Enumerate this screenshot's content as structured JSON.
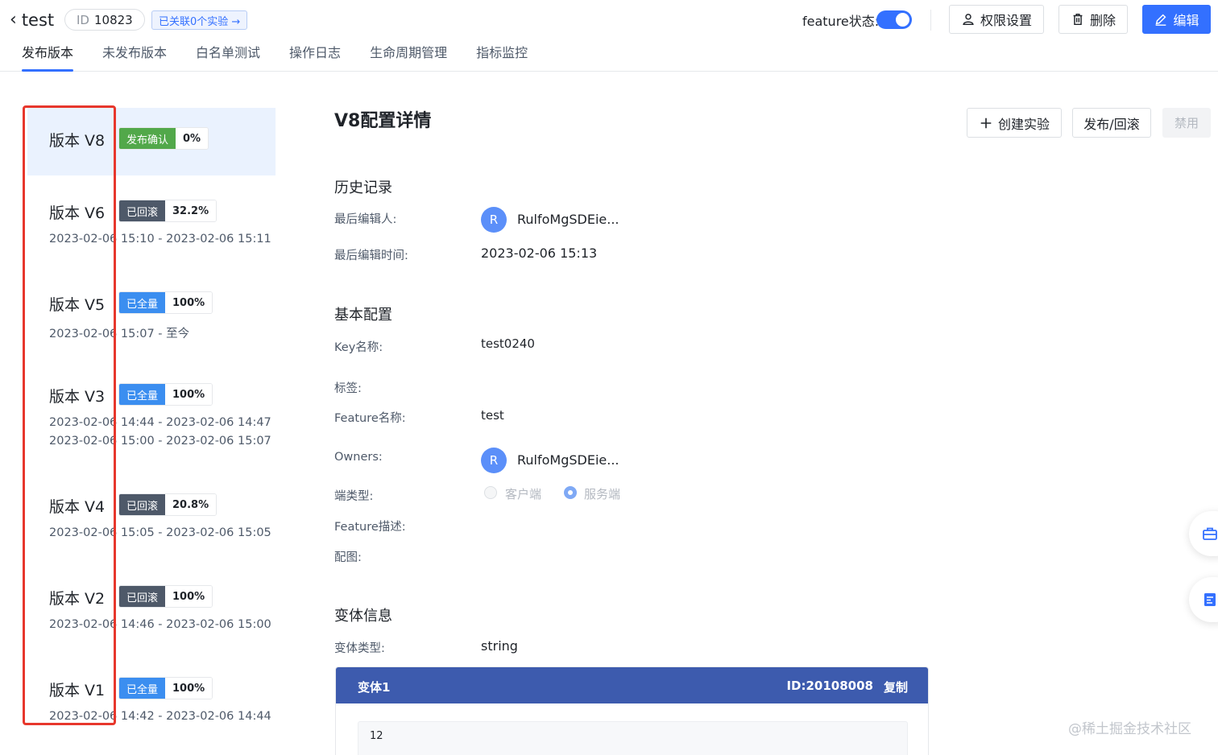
{
  "header": {
    "back_label": "test",
    "id_key": "ID",
    "id_value": "10823",
    "linked_label": "已关联0个实验 →",
    "feature_status_label": "feature状态:",
    "feature_status_on": true,
    "permissions_label": "权限设置",
    "delete_label": "删除",
    "edit_label": "编辑"
  },
  "tabs": [
    {
      "label": "发布版本",
      "active": true
    },
    {
      "label": "未发布版本",
      "active": false
    },
    {
      "label": "白名单测试",
      "active": false
    },
    {
      "label": "操作日志",
      "active": false
    },
    {
      "label": "生命周期管理",
      "active": false
    },
    {
      "label": "指标监控",
      "active": false
    }
  ],
  "versions": [
    {
      "title": "版本 V8",
      "status": "发布确认",
      "status_color": "#52a84a",
      "percent": "0%",
      "ranges": [],
      "selected": true
    },
    {
      "title": "版本 V6",
      "status": "已回滚",
      "status_color": "#4e5969",
      "percent": "32.2%",
      "ranges": [
        "2023-02-06 15:10 - 2023-02-06 15:11"
      ],
      "selected": false
    },
    {
      "title": "版本 V5",
      "status": "已全量",
      "status_color": "#3b8ef0",
      "percent": "100%",
      "ranges": [
        "2023-02-06 15:07 - 至今"
      ],
      "selected": false
    },
    {
      "title": "版本 V3",
      "status": "已全量",
      "status_color": "#3b8ef0",
      "percent": "100%",
      "ranges": [
        "2023-02-06 14:44 - 2023-02-06 14:47",
        "2023-02-06 15:00 - 2023-02-06 15:07"
      ],
      "selected": false
    },
    {
      "title": "版本 V4",
      "status": "已回滚",
      "status_color": "#4e5969",
      "percent": "20.8%",
      "ranges": [
        "2023-02-06 15:05 - 2023-02-06 15:05"
      ],
      "selected": false
    },
    {
      "title": "版本 V2",
      "status": "已回滚",
      "status_color": "#4e5969",
      "percent": "100%",
      "ranges": [
        "2023-02-06 14:46 - 2023-02-06 15:00"
      ],
      "selected": false
    },
    {
      "title": "版本 V1",
      "status": "已全量",
      "status_color": "#3b8ef0",
      "percent": "100%",
      "ranges": [
        "2023-02-06 14:42 - 2023-02-06 14:44"
      ],
      "selected": false
    }
  ],
  "detail": {
    "title": "V8配置详情",
    "create_experiment_label": "创建实验",
    "publish_rollback_label": "发布/回滚",
    "disable_label": "禁用",
    "history": {
      "section_title": "历史记录",
      "last_editor_label": "最后编辑人:",
      "last_editor_avatar": "R",
      "last_editor_name": "RulfoMgSDEie...",
      "last_edit_time_label": "最后编辑时间:",
      "last_edit_time": "2023-02-06 15:13"
    },
    "basic": {
      "section_title": "基本配置",
      "key_label": "Key名称:",
      "key_value": "test0240",
      "tags_label": "标签:",
      "feature_name_label": "Feature名称:",
      "feature_name": "test",
      "owners_label": "Owners:",
      "owner_avatar": "R",
      "owner_name": "RulfoMgSDEie...",
      "end_type_label": "端类型:",
      "end_type_client": "客户端",
      "end_type_server": "服务端",
      "end_type_selected": "服务端",
      "description_label": "Feature描述:",
      "image_label": "配图:"
    },
    "variant": {
      "section_title": "变体信息",
      "type_label": "变体类型:",
      "type_value": "string",
      "name": "变体1",
      "id_text": "ID:20108008",
      "copy_label": "复制",
      "value": "12"
    }
  },
  "watermark": "@稀土掘金技术社区",
  "colors": {
    "primary": "#3370ff",
    "highlight_frame": "#e7372c",
    "variant_header": "#3d5bae"
  }
}
